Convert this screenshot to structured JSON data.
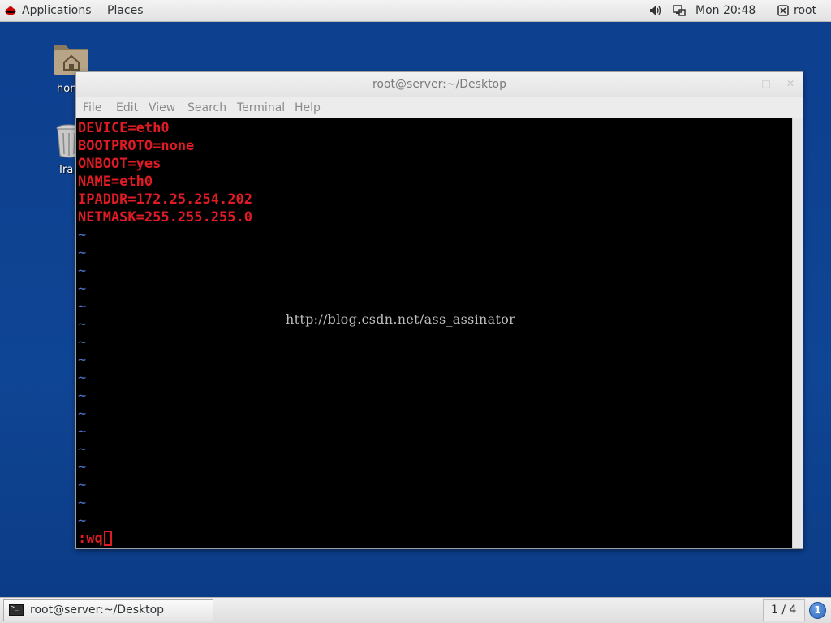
{
  "topbar": {
    "applications_label": "Applications",
    "places_label": "Places",
    "clock": "Mon 20:48",
    "user_label": "root"
  },
  "desktop": {
    "home_label": "hon",
    "trash_label": "Tra"
  },
  "terminal": {
    "title": "root@server:~/Desktop",
    "menu": [
      "File",
      "Edit",
      "View",
      "Search",
      "Terminal",
      "Help"
    ],
    "lines": [
      "DEVICE=eth0",
      "BOOTPROTO=none",
      "ONBOOT=yes",
      "NAME=eth0",
      "IPADDR=172.25.254.202",
      "NETMASK=255.255.255.0"
    ],
    "tilde": "~",
    "command": ":wq",
    "watermark": "http://blog.csdn.net/ass_assinator"
  },
  "taskbar": {
    "window_label": "root@server:~/Desktop",
    "workspace": "1 / 4",
    "notification_count": "1"
  },
  "colors": {
    "desktop_bg": "#0e4594",
    "terminal_text": "#e01b24",
    "tilde": "#4a6fc4"
  }
}
